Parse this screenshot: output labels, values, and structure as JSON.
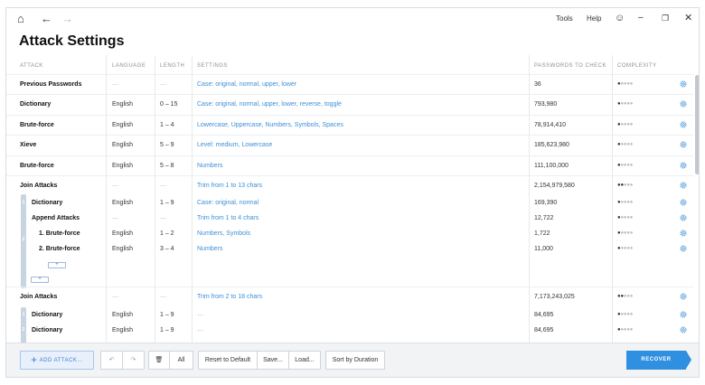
{
  "topbar": {
    "home_glyph": "⌂",
    "back_glyph": "←",
    "forward_glyph": "→",
    "menu": [
      "Tools",
      "Help"
    ],
    "smile_glyph": "☺",
    "minimize_glyph": "–",
    "restore_glyph": "❐",
    "close_glyph": "✕"
  },
  "page": {
    "title": "Attack Settings"
  },
  "columns": [
    "ATTACK",
    "LANGUAGE",
    "LENGTH",
    "SETTINGS",
    "PASSWORDS TO CHECK",
    "COMPLEXITY"
  ],
  "rows": [
    {
      "attack": "Previous Passwords",
      "language": "—",
      "length": "—",
      "settings": "Case: original, normal, upper, lower",
      "passwords": "36",
      "complexity_level": 1
    },
    {
      "attack": "Dictionary",
      "language": "English",
      "length": "0 – 15",
      "settings": "Case: original, normal, upper, lower, reverse, toggle",
      "passwords": "793,980",
      "complexity_level": 1
    },
    {
      "attack": "Brute-force",
      "language": "English",
      "length": "1 – 4",
      "settings": "Lowercase, Uppercase, Numbers, Symbols, Spaces",
      "passwords": "78,914,410",
      "complexity_level": 1
    },
    {
      "attack": "Xieve",
      "language": "English",
      "length": "5 – 9",
      "settings": "Level: medium, Lowercase",
      "passwords": "185,623,980",
      "complexity_level": 1
    },
    {
      "attack": "Brute-force",
      "language": "English",
      "length": "5 – 8",
      "settings": "Numbers",
      "passwords": "111,100,000",
      "complexity_level": 1
    },
    {
      "attack": "Join Attacks",
      "language": "—",
      "length": "—",
      "settings": "Trim from 1 to 13 chars",
      "passwords": "2,154,979,580",
      "complexity_level": 2
    },
    {
      "attack": "Dictionary",
      "language": "English",
      "length": "1 – 9",
      "settings": "Case: original, normal",
      "passwords": "169,390",
      "complexity_level": 1
    },
    {
      "attack": "Append Attacks",
      "language": "—",
      "length": "—",
      "settings": "Trim from 1 to 4 chars",
      "passwords": "12,722",
      "complexity_level": 1
    },
    {
      "attack": "1. Brute-force",
      "language": "English",
      "length": "1 – 2",
      "settings": "Numbers, Symbols",
      "passwords": "1,722",
      "complexity_level": 1
    },
    {
      "attack": "2. Brute-force",
      "language": "English",
      "length": "3 – 4",
      "settings": "Numbers",
      "passwords": "11,000",
      "complexity_level": 1
    },
    {
      "attack": "Join Attacks",
      "language": "—",
      "length": "—",
      "settings": "Trim from 2 to 18 chars",
      "passwords": "7,173,243,025",
      "complexity_level": 2
    },
    {
      "attack": "Dictionary",
      "language": "English",
      "length": "1 – 9",
      "settings": "—",
      "passwords": "84,695",
      "complexity_level": 1
    },
    {
      "attack": "Dictionary",
      "language": "English",
      "length": "1 – 9",
      "settings": "—",
      "passwords": "84,695",
      "complexity_level": 1
    }
  ],
  "group_numbers": [
    "1",
    "2",
    "1",
    "2"
  ],
  "plus_glyph": "+",
  "toolbar": {
    "add_label": "ADD ATTACK...",
    "add_icon": "+",
    "undo_glyph": "↶",
    "redo_glyph": "↷",
    "trash_glyph": "🗑",
    "all_label": "All",
    "reset_label": "Reset to Default",
    "save_label": "Save...",
    "load_label": "Load...",
    "sort_label": "Sort by Duration",
    "recover_label": "RECOVER"
  },
  "colors": {
    "accent": "#2f8fe0",
    "link": "#3d8fd8"
  }
}
